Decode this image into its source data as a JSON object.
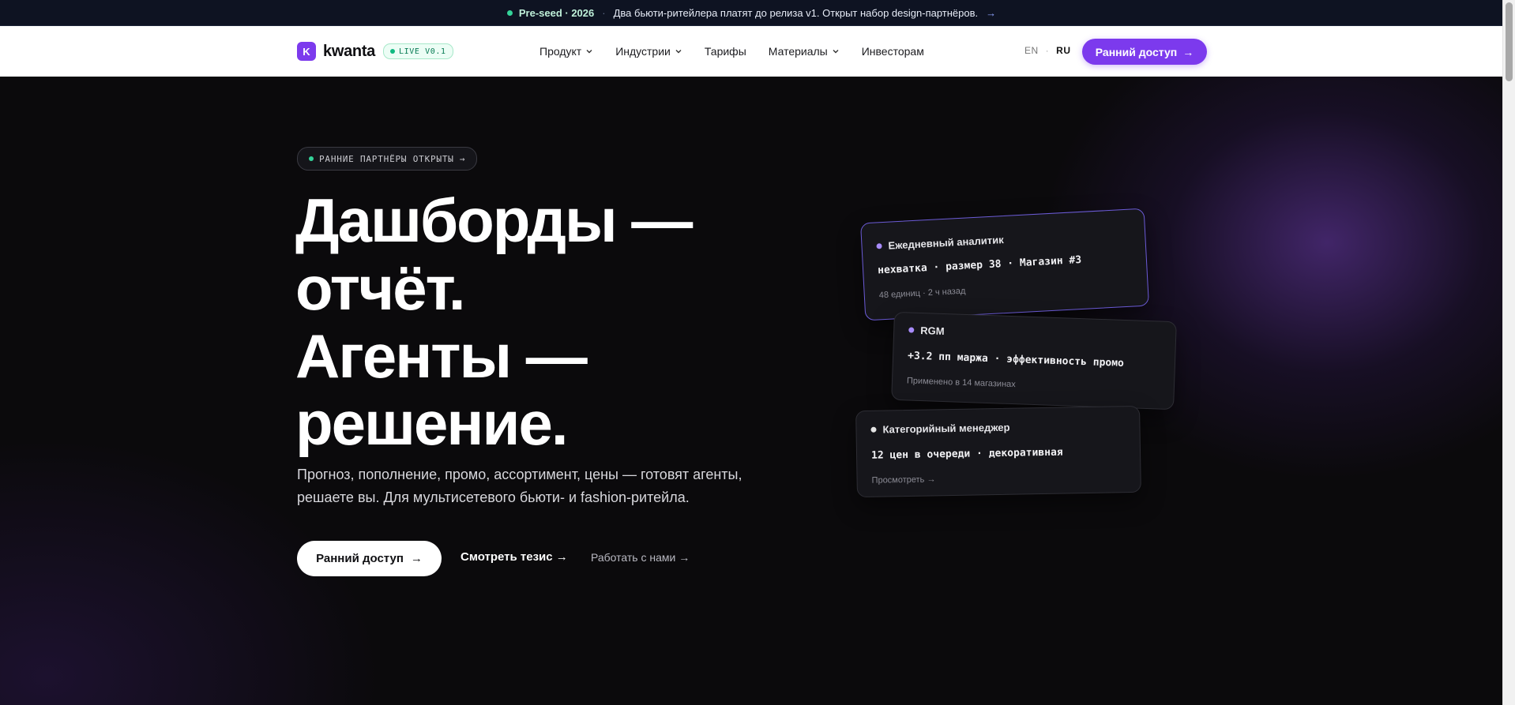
{
  "announcement": {
    "badge": "Pre-seed · 2026",
    "separator": "·",
    "text": "Два бьюти-ритейлера платят до релиза v1. Открыт набор design-партнёров.",
    "arrow": "→"
  },
  "nav": {
    "logo_letter": "K",
    "logo_text": "kwanta",
    "live_badge": "LIVE V0.1",
    "menu": [
      {
        "label": "Продукт"
      },
      {
        "label": "Индустрии"
      },
      {
        "label": "Тарифы"
      },
      {
        "label": "Материалы"
      },
      {
        "label": "Инвесторам"
      }
    ],
    "lang_en": "EN",
    "lang_sep": "·",
    "lang_ru": "RU",
    "cta": "Ранний доступ",
    "cta_arrow": "→"
  },
  "hero": {
    "pill": "РАННИЕ ПАРТНЁРЫ ОТКРЫТЫ",
    "pill_arrow": "→",
    "headline": [
      "Дашборды —",
      "отчёт.",
      "Агенты —",
      "решение."
    ],
    "subtitle": "Прогноз, пополнение, промо, ассортимент, цены — готовят агенты, решаете вы. Для мультисетевого бьюти- и fashion-ритейла.",
    "btn_primary": "Ранний доступ",
    "btn_primary_arrow": "→",
    "link_thesis": "Смотреть тезис →",
    "link_work": "Работать с нами →"
  },
  "cards": [
    {
      "title": "Ежедневный аналитик",
      "line": "нехватка · размер 38 · Магазин #3",
      "meta": "48 единиц · 2 ч назад",
      "dot_color": "#a78bfa"
    },
    {
      "title": "RGM",
      "line": "+3.2 пп маржа · эффективность промо",
      "meta": "Применено в 14 магазинах",
      "dot_color": "#a78bfa"
    },
    {
      "title": "Категорийный менеджер",
      "line": "12 цен в очереди · декоративная",
      "meta": "Просмотреть →",
      "dot_color": "#e5e5e5"
    }
  ],
  "colors": {
    "accent": "#7c3aed",
    "live_green": "#10b981",
    "background": "#0b0a0c"
  }
}
